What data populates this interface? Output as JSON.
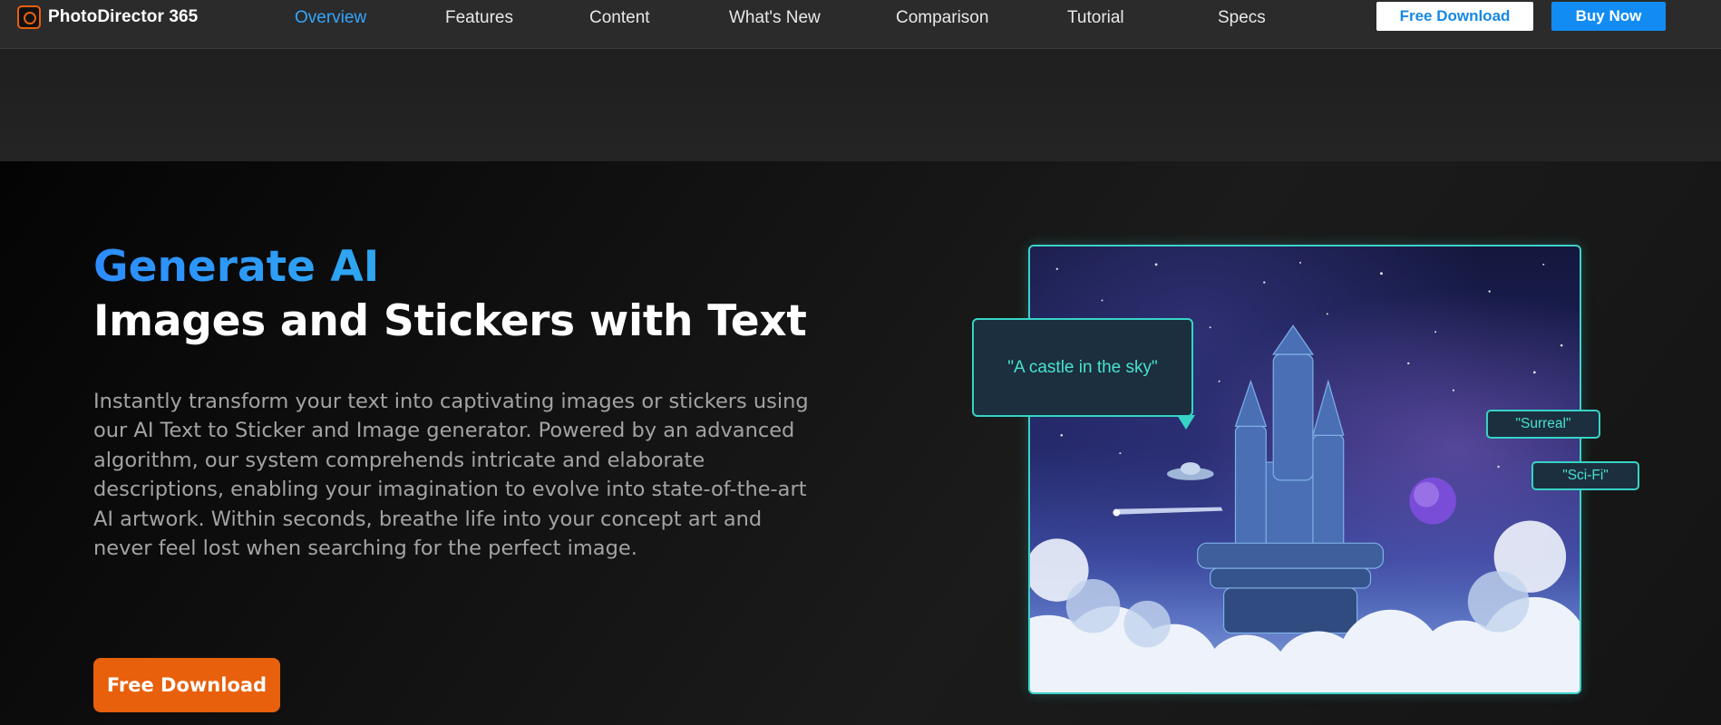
{
  "header": {
    "brand": "PhotoDirector 365",
    "nav": [
      {
        "label": "Overview",
        "active": true
      },
      {
        "label": "Features",
        "active": false
      },
      {
        "label": "Content",
        "active": false
      },
      {
        "label": "What's New",
        "active": false
      },
      {
        "label": "Comparison",
        "active": false
      },
      {
        "label": "Tutorial",
        "active": false
      },
      {
        "label": "Specs",
        "active": false
      }
    ],
    "free_download": "Free Download",
    "buy_now": "Buy Now"
  },
  "hero": {
    "title_highlight": "Generate AI",
    "title_rest": "Images and Stickers with Text",
    "description": "Instantly transform your text into captivating images or stickers using our AI Text to Sticker and Image generator. Powered by an advanced algorithm, our system comprehends intricate and elaborate descriptions, enabling your imagination to evolve into state-of-the-art AI artwork. Within seconds, breathe life into your concept art and never feel lost when searching for the perfect image.",
    "cta": "Free Download"
  },
  "artwork": {
    "prompt": "\"A castle in the sky\"",
    "tags": [
      "\"Surreal\"",
      "\"Sci-Fi\""
    ]
  },
  "colors": {
    "accent_blue": "#33a6ff",
    "gradient_start": "#2d8cff",
    "gradient_end": "#2fd8d6",
    "orange_cta": "#e8600c",
    "teal_border": "#37d3c6",
    "buy_blue": "#128cf3"
  }
}
